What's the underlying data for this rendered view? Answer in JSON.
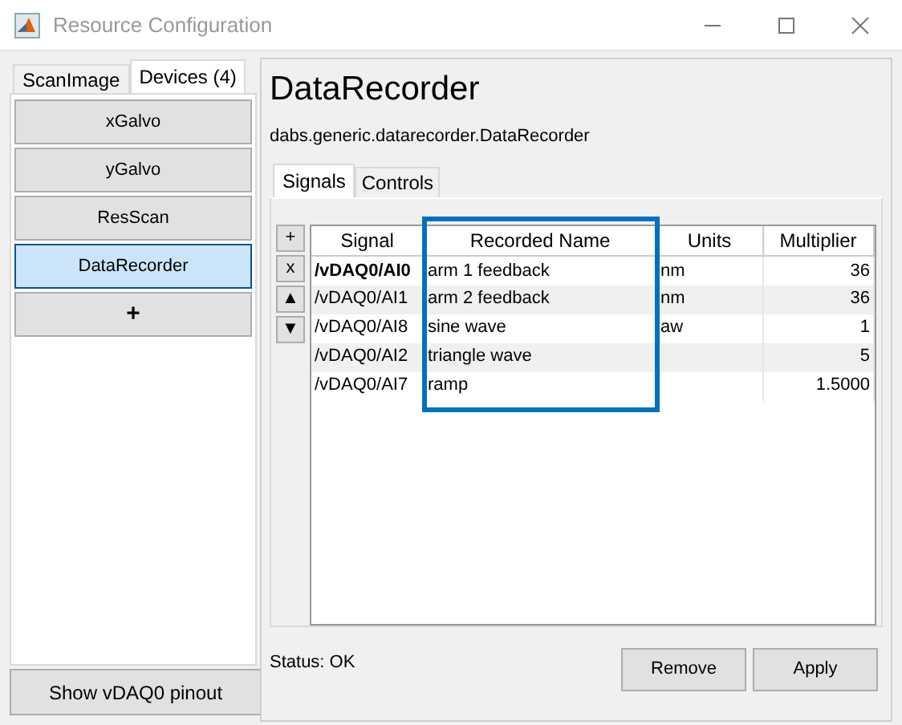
{
  "window": {
    "title": "Resource Configuration"
  },
  "left_tabs": [
    {
      "label": "ScanImage",
      "selected": false
    },
    {
      "label": "Devices (4)",
      "selected": true
    }
  ],
  "devices": [
    {
      "label": "xGalvo",
      "selected": false
    },
    {
      "label": "yGalvo",
      "selected": false
    },
    {
      "label": "ResScan",
      "selected": false
    },
    {
      "label": "DataRecorder",
      "selected": true
    }
  ],
  "add_device": "+",
  "pinout_button": "Show vDAQ0 pinout",
  "device": {
    "title": "DataRecorder",
    "class_name": "dabs.generic.datarecorder.DataRecorder"
  },
  "tabs": [
    {
      "label": "Signals",
      "selected": true
    },
    {
      "label": "Controls",
      "selected": false
    }
  ],
  "row_buttons": [
    "+",
    "x",
    "▲",
    "▼"
  ],
  "table": {
    "columns": [
      "Signal",
      "Recorded Name",
      "Units",
      "Multiplier"
    ],
    "rows": [
      {
        "selected": true,
        "cells": [
          "/vDAQ0/AI0",
          "arm 1 feedback",
          "nm",
          "36"
        ]
      },
      {
        "selected": false,
        "cells": [
          "/vDAQ0/AI1",
          "arm 2 feedback",
          "nm",
          "36"
        ]
      },
      {
        "selected": false,
        "cells": [
          "/vDAQ0/AI8",
          "sine wave",
          "aw",
          "1"
        ]
      },
      {
        "selected": false,
        "cells": [
          "/vDAQ0/AI2",
          "triangle wave",
          "",
          "5"
        ]
      },
      {
        "selected": false,
        "cells": [
          "/vDAQ0/AI7",
          "ramp",
          "",
          "1.5000"
        ]
      }
    ]
  },
  "status": "Status: OK",
  "buttons": [
    "Remove",
    "Apply"
  ]
}
